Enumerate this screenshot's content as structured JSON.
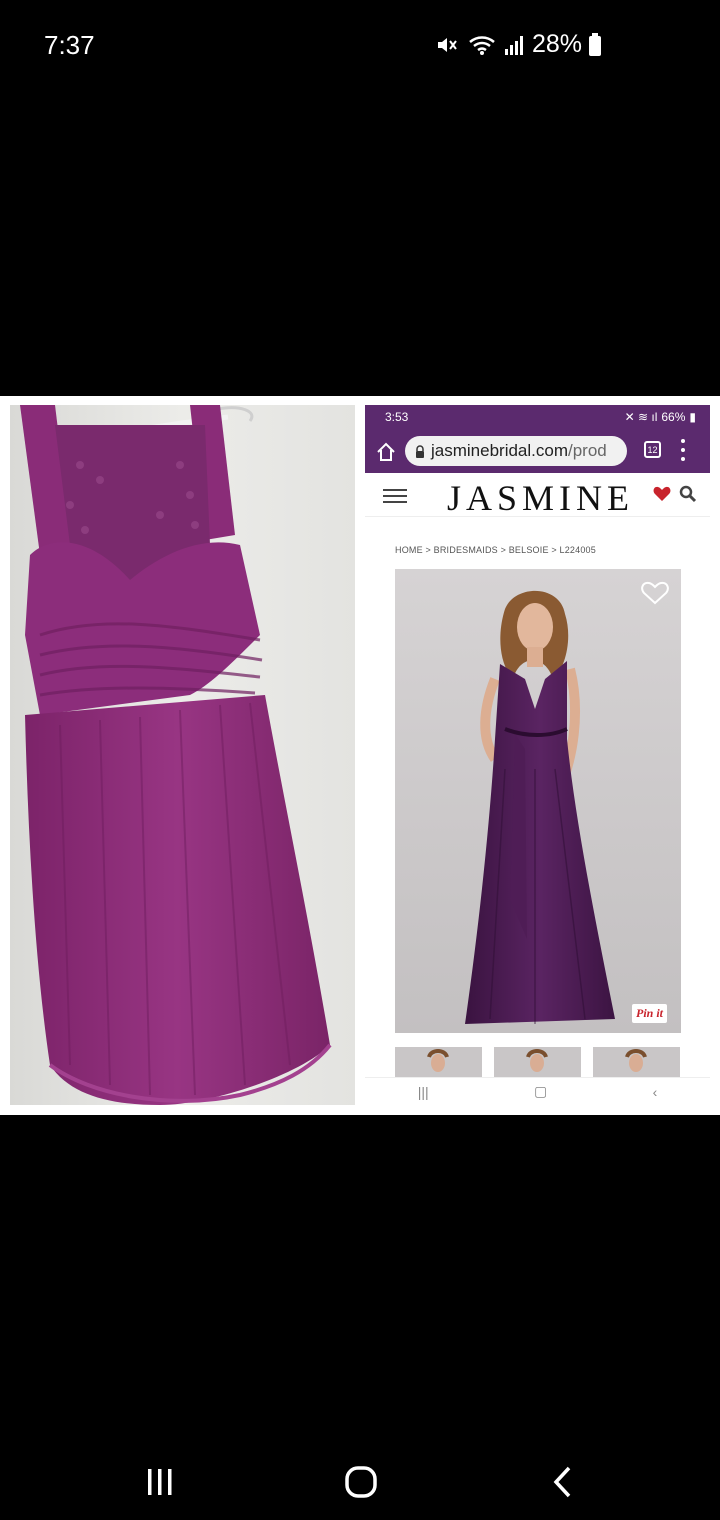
{
  "status_bar": {
    "time": "7:37",
    "battery": "28%",
    "icons": [
      "mute-vibrate-icon",
      "wifi-icon",
      "signal-icon",
      "battery-icon"
    ]
  },
  "inner_screenshot": {
    "status_time": "3:53",
    "status_battery": "66%",
    "url_host": "jasminebridal.com",
    "url_path": "/prod",
    "tab_count": "12",
    "site_logo": "JASMINE",
    "breadcrumb": "HOME > BRIDESMAIDS > BELSOIE > L224005",
    "pinit_label": "Pin it",
    "thumbnail_count": 3
  },
  "colors": {
    "dress_purple": "#8e2f7e",
    "browser_purple": "#5b2a6e",
    "gown_purple": "#4a1d4f"
  },
  "navigation": [
    "recent-apps-button",
    "home-button",
    "back-button"
  ]
}
